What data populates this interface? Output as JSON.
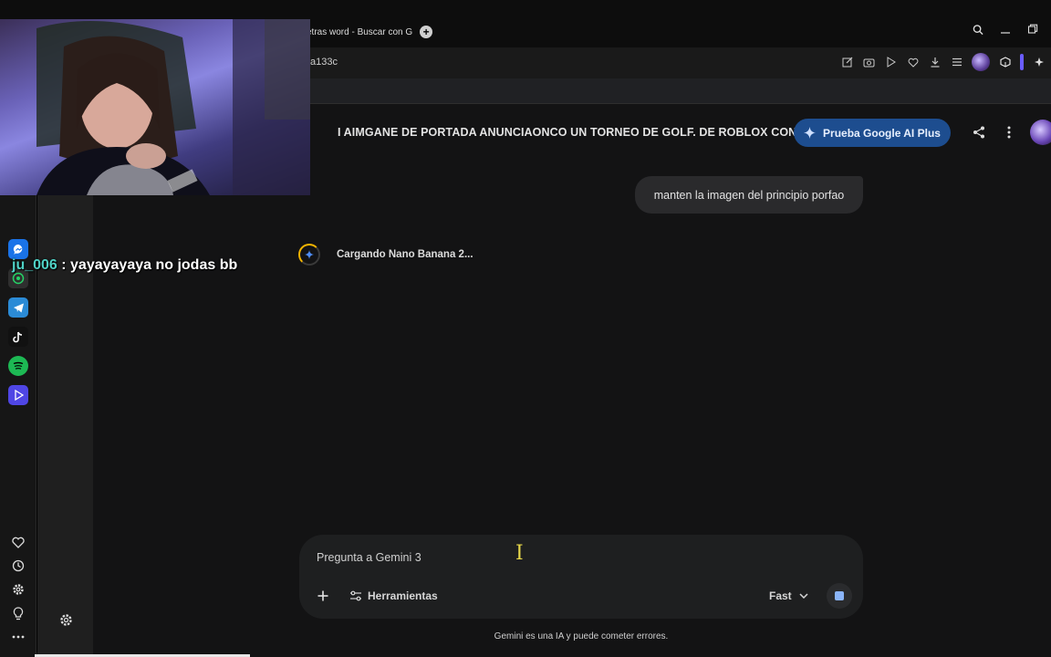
{
  "browser": {
    "tab_title": "etras word - Buscar con G",
    "new_tab_symbol": "+",
    "url_fragment": "a133c"
  },
  "gemini": {
    "conversation_title": "I AIMGANE DE PORTADA ANUNCIAONCO UN TORNEO DE GOLF. DE ROBLOX CON",
    "upgrade_button": "Prueba Google AI Plus",
    "user_message": "manten la imagen del principio porfao",
    "loading_text": "Cargando Nano Banana 2...",
    "input_placeholder": "Pregunta a Gemini 3",
    "tools_label": "Herramientas",
    "model_label": "Fast",
    "disclaimer": "Gemini es una IA y puede cometer errores.",
    "accent_color": "#1d4d8f"
  },
  "stream_chat": {
    "username": "ju_006",
    "message": " : yayayayaya no jodas bb"
  },
  "dock_apps": [
    "messenger-icon",
    "whatsapp-icon",
    "telegram-icon",
    "tiktok-icon",
    "spotify-icon",
    "video-player-icon"
  ],
  "dock_bottom": [
    "heart-icon",
    "history-icon",
    "settings-icon",
    "lightbulb-icon",
    "more-icon"
  ]
}
